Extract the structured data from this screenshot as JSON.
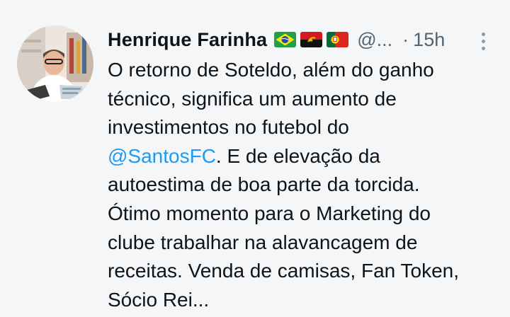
{
  "tweet": {
    "author_name": "Henrique Farinha",
    "flags": [
      "brazil-flag-icon",
      "angola-flag-icon",
      "portugal-flag-icon"
    ],
    "handle": "@...",
    "separator": "·",
    "timestamp": "15h",
    "more_icon": "more-options-icon",
    "text_lines": {
      "l1": "O retorno de Soteldo, além do ganho",
      "l2": "técnico, significa um aumento de",
      "l3": "investimentos no futebol do",
      "l4_mention": "@SantosFC",
      "l4_rest": ". E de elevação da",
      "l5": "autoestima de boa parte da torcida.",
      "l6": "Ótimo momento para o Marketing do",
      "l7": "clube trabalhar na alavancagem de",
      "l8": "receitas. Venda de camisas, Fan Token,",
      "l9": "Sócio Rei..."
    }
  },
  "colors": {
    "background": "#f4f6f7",
    "text": "#0f1419",
    "secondary": "#536471",
    "link": "#1d9bf0"
  }
}
